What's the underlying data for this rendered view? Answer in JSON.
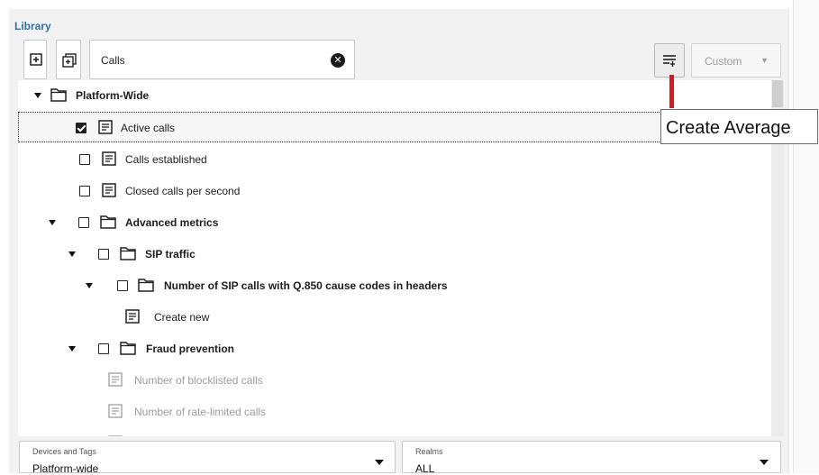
{
  "library": {
    "title": "Library",
    "search": {
      "value": "Calls",
      "placeholder": ""
    },
    "custom_label": "Custom",
    "tooltip": "Create Average"
  },
  "tree": [
    {
      "label": "Platform-Wide",
      "type": "folder",
      "bold": true,
      "expanded": true
    },
    {
      "label": "Active calls",
      "type": "metric",
      "checked": true,
      "selected": true
    },
    {
      "label": "Calls established",
      "type": "metric",
      "checked": false
    },
    {
      "label": "Closed calls per second",
      "type": "metric",
      "checked": false
    },
    {
      "label": "Advanced metrics",
      "type": "folder",
      "bold": true,
      "expanded": true,
      "checked": false
    },
    {
      "label": "SIP traffic",
      "type": "folder",
      "bold": true,
      "expanded": true,
      "checked": false
    },
    {
      "label": "Number of SIP calls with Q.850 cause codes in headers",
      "type": "folder",
      "bold": true,
      "expanded": true,
      "checked": false
    },
    {
      "label": "Create new",
      "type": "metric"
    },
    {
      "label": "Fraud prevention",
      "type": "folder",
      "bold": true,
      "expanded": true,
      "checked": false
    },
    {
      "label": "Number of blocklisted calls",
      "type": "metric",
      "disabled": true
    },
    {
      "label": "Number of rate-limited calls",
      "type": "metric",
      "disabled": true
    }
  ],
  "filters": {
    "devices": {
      "label": "Devices and Tags",
      "value": "Platform-wide"
    },
    "realms": {
      "label": "Realms",
      "value": "ALL"
    }
  },
  "colors": {
    "title": "#2f6fb3",
    "accent_bar": "#e0161c"
  }
}
